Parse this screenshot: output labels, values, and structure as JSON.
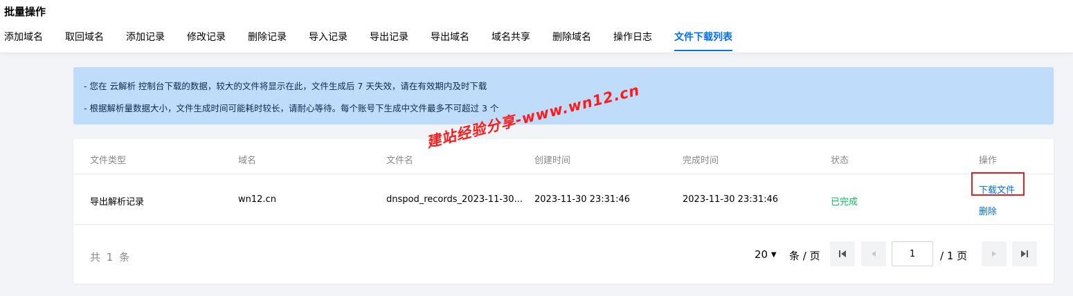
{
  "header": {
    "title": "批量操作"
  },
  "tabs": [
    {
      "label": "添加域名"
    },
    {
      "label": "取回域名"
    },
    {
      "label": "添加记录"
    },
    {
      "label": "修改记录"
    },
    {
      "label": "删除记录"
    },
    {
      "label": "导入记录"
    },
    {
      "label": "导出记录"
    },
    {
      "label": "导出域名"
    },
    {
      "label": "域名共享"
    },
    {
      "label": "删除域名"
    },
    {
      "label": "操作日志"
    },
    {
      "label": "文件下载列表",
      "active": true
    }
  ],
  "notice": {
    "line1": "- 您在 云解析 控制台下载的数据，较大的文件将显示在此，文件生成后 7 天失效，请在有效期内及时下载",
    "line2": "- 根据解析量数据大小，文件生成时间可能耗时较长，请耐心等待。每个账号下生成中文件最多不可超过 3 个"
  },
  "watermark": "建站经验分享-www.wn12.cn",
  "table": {
    "columns": [
      "文件类型",
      "域名",
      "文件名",
      "创建时间",
      "完成时间",
      "状态",
      "操作"
    ],
    "rows": [
      {
        "type": "导出解析记录",
        "domain": "wn12.cn",
        "filename": "dnspod_records_2023-11-30...",
        "created": "2023-11-30 23:31:46",
        "finished": "2023-11-30 23:31:46",
        "status": "已完成",
        "actions": {
          "download": "下载文件",
          "delete": "删除"
        }
      }
    ]
  },
  "pagination": {
    "total_text": "共 1 条",
    "page_size": "20",
    "page_size_unit": "条 / 页",
    "current_page": "1",
    "total_pages_text": "/ 1 页"
  },
  "colors": {
    "accent": "#006eff",
    "status_success": "#0abf5b",
    "notice_bg": "#bfdcfb",
    "highlight_border": "#e0201d",
    "watermark": "#ff1a1a"
  }
}
